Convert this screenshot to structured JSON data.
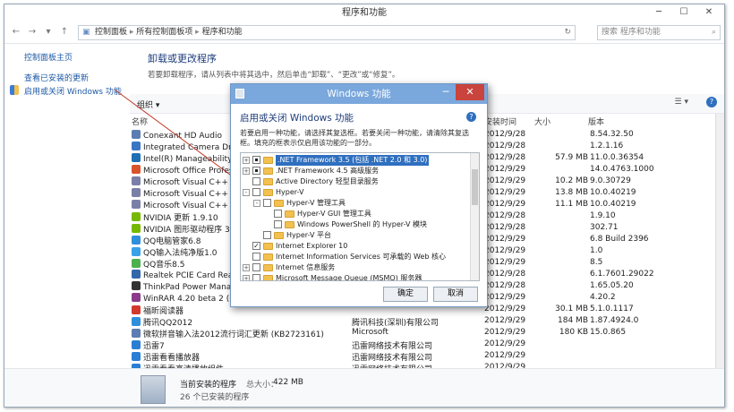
{
  "window": {
    "title": "程序和功能"
  },
  "address": {
    "path": [
      "控制面板",
      "所有控制面板项",
      "程序和功能"
    ],
    "search_placeholder": "搜索 程序和功能"
  },
  "sidebar": {
    "items": [
      {
        "label": "控制面板主页"
      },
      {
        "label": "查看已安装的更新"
      },
      {
        "label": "启用或关闭 Windows 功能"
      }
    ]
  },
  "main": {
    "heading": "卸载或更改程序",
    "description": "若要卸载程序，请从列表中将其选中，然后单击“卸载”、“更改”或“修复”。",
    "organize": "组织",
    "columns": [
      "名称",
      "安装时间",
      "大小",
      "版本"
    ],
    "rows": [
      {
        "name": "Conexant HD Audio",
        "publisher": "",
        "date": "2012/9/28",
        "size": "",
        "version": "8.54.32.50",
        "color": "#5b7db1"
      },
      {
        "name": "Integrated Camera Drive",
        "publisher": "",
        "date": "2012/9/28",
        "size": "",
        "version": "1.2.1.16",
        "color": "#3a76c4"
      },
      {
        "name": "Intel(R) Manageability Ei",
        "publisher": "",
        "date": "2012/9/28",
        "size": "57.9 MB",
        "version": "11.0.0.36354",
        "color": "#1f6fb5"
      },
      {
        "name": "Microsoft Office Profese",
        "publisher": "",
        "date": "2012/9/29",
        "size": "",
        "version": "14.0.4763.1000",
        "color": "#d9542b"
      },
      {
        "name": "Microsoft Visual C++ 20",
        "publisher": "",
        "date": "2012/9/29",
        "size": "10.2 MB",
        "version": "9.0.30729",
        "color": "#7a7fa8"
      },
      {
        "name": "Microsoft Visual C++ 20",
        "publisher": "",
        "date": "2012/9/29",
        "size": "13.8 MB",
        "version": "10.0.40219",
        "color": "#7a7fa8"
      },
      {
        "name": "Microsoft Visual C++ 20",
        "publisher": "",
        "date": "2012/9/29",
        "size": "11.1 MB",
        "version": "10.0.40219",
        "color": "#7a7fa8"
      },
      {
        "name": "NVIDIA 更新 1.9.10",
        "publisher": "",
        "date": "2012/9/28",
        "size": "",
        "version": "1.9.10",
        "color": "#76b900"
      },
      {
        "name": "NVIDIA 图形驱动程序 302",
        "publisher": "",
        "date": "2012/9/28",
        "size": "",
        "version": "302.71",
        "color": "#76b900"
      },
      {
        "name": "QQ电脑管家6.8",
        "publisher": "",
        "date": "2012/9/29",
        "size": "",
        "version": "6.8 Build 2396",
        "color": "#2f8fdc"
      },
      {
        "name": "QQ输入法纯净版1.0",
        "publisher": "",
        "date": "2012/9/29",
        "size": "",
        "version": "1.0",
        "color": "#3aa0e8"
      },
      {
        "name": "QQ音乐8.5",
        "publisher": "",
        "date": "2012/9/29",
        "size": "",
        "version": "8.5",
        "color": "#4bb24b"
      },
      {
        "name": "Realtek PCIE Card Reade",
        "publisher": "",
        "date": "2012/9/28",
        "size": "",
        "version": "6.1.7601.29022",
        "color": "#3366aa"
      },
      {
        "name": "ThinkPad Power Manage",
        "publisher": "",
        "date": "2012/9/28",
        "size": "",
        "version": "1.65.05.20",
        "color": "#333333"
      },
      {
        "name": "WinRAR 4.20 beta 2 (64",
        "publisher": "",
        "date": "2012/9/29",
        "size": "",
        "version": "4.20.2",
        "color": "#8b3a8b"
      },
      {
        "name": "福昕阅读器",
        "publisher": "",
        "date": "2012/9/29",
        "size": "30.1 MB",
        "version": "5.1.0.1117",
        "color": "#d23a2e"
      },
      {
        "name": "腾讯QQ2012",
        "publisher": "腾讯科技(深圳)有限公司",
        "date": "2012/9/29",
        "size": "184 MB",
        "version": "1.87.4924.0",
        "color": "#2f8fdc"
      },
      {
        "name": "微软拼音输入法2012流行词汇更新 (KB2723161)",
        "publisher": "Microsoft",
        "date": "2012/9/29",
        "size": "180 KB",
        "version": "15.0.865",
        "color": "#5b7db1"
      },
      {
        "name": "迅雷7",
        "publisher": "迅雷网络技术有限公司",
        "date": "2012/9/29",
        "size": "",
        "version": "",
        "color": "#2a7ed4"
      },
      {
        "name": "迅雷看看播放器",
        "publisher": "迅雷网络技术有限公司",
        "date": "2012/9/29",
        "size": "",
        "version": "",
        "color": "#2a7ed4"
      },
      {
        "name": "迅雷看看高清播放组件",
        "publisher": "迅雷网络技术有限公司",
        "date": "2012/9/29",
        "size": "",
        "version": "",
        "color": "#2a7ed4"
      }
    ]
  },
  "status": {
    "label": "当前安装的程序",
    "total_label": "总大小：",
    "total_size": "422 MB",
    "count": "26 个已安装的程序"
  },
  "dialog": {
    "title": "Windows 功能",
    "heading": "启用或关闭 Windows 功能",
    "description": "若要启用一种功能，请选择其复选框。若要关闭一种功能，请清除其复选框。填充的框表示仅启用该功能的一部分。",
    "features": [
      {
        "label": ".NET Framework 3.5 (包括 .NET 2.0 和 3.0)",
        "level": 0,
        "expander": "+",
        "state": "part",
        "selected": true
      },
      {
        "label": ".NET Framework 4.5 高级服务",
        "level": 0,
        "expander": "+",
        "state": "part",
        "selected": false
      },
      {
        "label": "Active Directory 轻型目录服务",
        "level": 0,
        "expander": "",
        "state": "off",
        "selected": false
      },
      {
        "label": "Hyper-V",
        "level": 0,
        "expander": "-",
        "state": "off",
        "selected": false
      },
      {
        "label": "Hyper-V 管理工具",
        "level": 1,
        "expander": "-",
        "state": "off",
        "selected": false
      },
      {
        "label": "Hyper-V GUI 管理工具",
        "level": 2,
        "expander": "",
        "state": "off",
        "selected": false
      },
      {
        "label": "Windows PowerShell 的 Hyper-V 模块",
        "level": 2,
        "expander": "",
        "state": "off",
        "selected": false
      },
      {
        "label": "Hyper-V 平台",
        "level": 1,
        "expander": "",
        "state": "off",
        "selected": false
      },
      {
        "label": "Internet Explorer 10",
        "level": 0,
        "expander": "",
        "state": "on",
        "selected": false
      },
      {
        "label": "Internet Information Services 可承载的 Web 核心",
        "level": 0,
        "expander": "",
        "state": "off",
        "selected": false
      },
      {
        "label": "Internet 信息服务",
        "level": 0,
        "expander": "+",
        "state": "off",
        "selected": false
      },
      {
        "label": "Microsoft Message Queue (MSMQ) 服务器",
        "level": 0,
        "expander": "+",
        "state": "off",
        "selected": false
      }
    ],
    "ok": "确定",
    "cancel": "取消"
  },
  "colors": {
    "accent": "#7aa7dc",
    "link": "#1f5aa6",
    "close": "#c9443d"
  }
}
